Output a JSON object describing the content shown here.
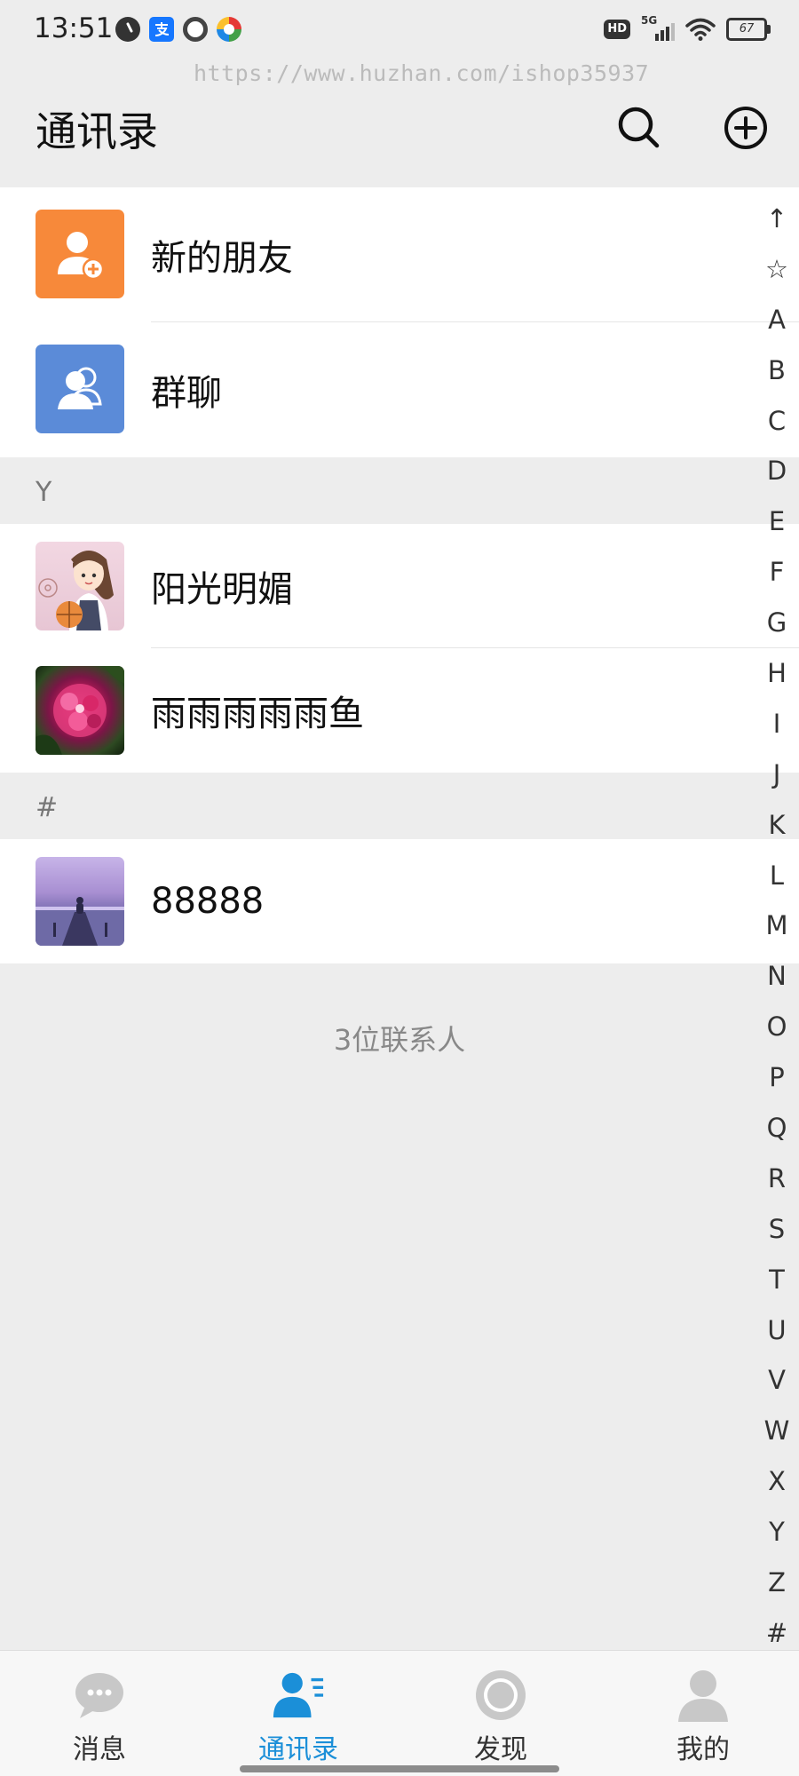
{
  "status_bar": {
    "time": "13:51",
    "network": "5G",
    "hd": "HD",
    "battery": "67"
  },
  "watermark": "https://www.huzhan.com/ishop35937",
  "header": {
    "title": "通讯录"
  },
  "special_entries": [
    {
      "label": "新的朋友",
      "icon": "person-add-icon",
      "color": "#F7893A"
    },
    {
      "label": "群聊",
      "icon": "group-icon",
      "color": "#5B8BD8"
    }
  ],
  "sections": [
    {
      "header": "Y",
      "contacts": [
        {
          "name": "阳光明媚",
          "avatar": "cartoon-girl-basketball"
        },
        {
          "name": "雨雨雨雨雨鱼",
          "avatar": "pink-flower-photo"
        }
      ]
    },
    {
      "header": "#",
      "contacts": [
        {
          "name": "88888",
          "avatar": "lake-pier-photo"
        }
      ]
    }
  ],
  "contact_count": "3位联系人",
  "alpha_index": [
    "↑",
    "☆",
    "A",
    "B",
    "C",
    "D",
    "E",
    "F",
    "G",
    "H",
    "I",
    "J",
    "K",
    "L",
    "M",
    "N",
    "O",
    "P",
    "Q",
    "R",
    "S",
    "T",
    "U",
    "V",
    "W",
    "X",
    "Y",
    "Z",
    "#"
  ],
  "bottom_nav": [
    {
      "label": "消息",
      "icon": "chat-bubble-icon",
      "active": false
    },
    {
      "label": "通讯录",
      "icon": "contacts-icon",
      "active": true
    },
    {
      "label": "发现",
      "icon": "discover-icon",
      "active": false
    },
    {
      "label": "我的",
      "icon": "profile-icon",
      "active": false
    }
  ],
  "colors": {
    "accent": "#1B8FD8",
    "background": "#EDEDED",
    "inactive_icon": "#C8C8C8"
  }
}
